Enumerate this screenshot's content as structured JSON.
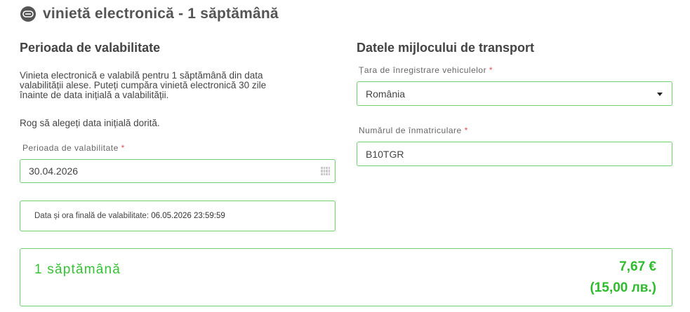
{
  "header": {
    "title": "vinietă electronică - 1 săptămână",
    "icon": "vignette-icon"
  },
  "validity": {
    "section_title": "Perioada de valabilitate",
    "paragraph_line1": "Vinieta electronică e valabilă pentru 1 săptămână din data",
    "paragraph_line2": "valabilității alese. Puteți cumpăra vinietă electronică 30 zile",
    "paragraph_line3": "înainte de data inițială a valabilității.",
    "select_date_text": "Rog să alegeți data inițială dorită.",
    "date_label": "Perioada de valabilitate",
    "date_value": "30.04.2026",
    "end_label": "Data și ora finală de valabilitate:",
    "end_value": "06.05.2026 23:59:59"
  },
  "vehicle": {
    "section_title": "Datele mijlocului de transport",
    "country_label": "Țara de înregistrare vehiculelor",
    "country_value": "România",
    "plate_label": "Numărul de înmatriculare",
    "plate_value": "B10TGR"
  },
  "required_mark": "*",
  "summary": {
    "period": "1 săptămână",
    "price_eur": "7,67 €",
    "price_bgn": "(15,00 лв.)"
  },
  "colors": {
    "accent_green": "#2ebb2e",
    "border_green": "#6fd16f",
    "required_red": "#d9534f"
  }
}
